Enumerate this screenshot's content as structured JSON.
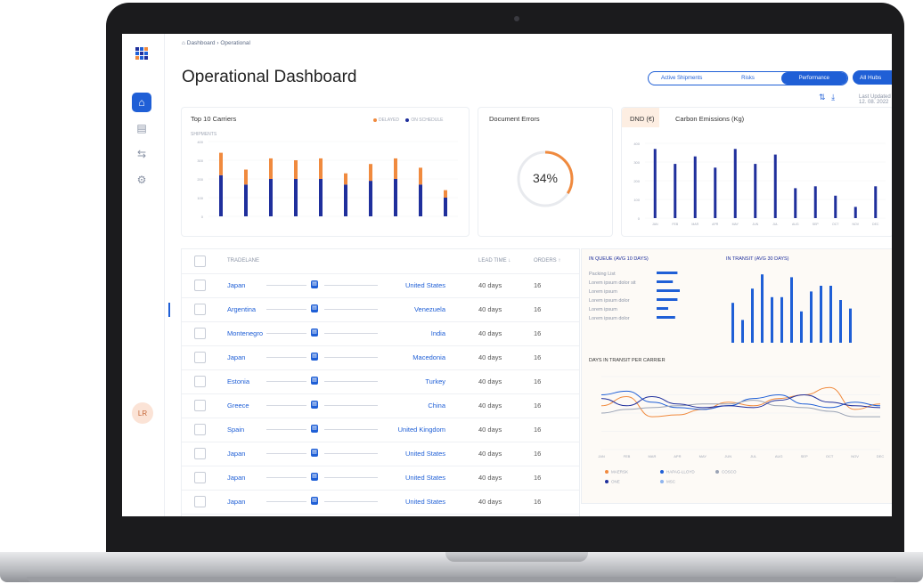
{
  "app": {
    "breadcrumb": [
      "Dashboard",
      "Operational"
    ],
    "page_title": "Operational Dashboard",
    "tabs": [
      "Active Shipments",
      "Risks",
      "Performance"
    ],
    "active_tab": "Performance",
    "hubs_select": "All Hubs",
    "last_updated": "Last Updated 12. 08. 2022",
    "avatar_initials": "LR",
    "colors": {
      "accent": "#1f5fd6",
      "orange": "#f08a3e",
      "navy": "#1f2f9c"
    }
  },
  "top_carriers": {
    "title": "Top 10 Carriers",
    "legend": [
      {
        "label": "DELAYED",
        "color": "#f08a3e"
      },
      {
        "label": "ON SCHEDULE",
        "color": "#1f2f9c"
      }
    ],
    "ylabel": "SHIPMENTS",
    "yticks": [
      "400",
      "300",
      "200",
      "100",
      "0"
    ]
  },
  "document_errors": {
    "title": "Document Errors",
    "value": "34%",
    "fraction": 0.34
  },
  "dnd": {
    "tab_dnd": "DND (€)",
    "tab_carbon": "Carbon Emissions (Kg)",
    "yticks": [
      "400",
      "300",
      "200",
      "100",
      "0"
    ]
  },
  "table": {
    "headers": {
      "tradelane": "TRADELANE",
      "lead_time": "LEAD TIME ↓",
      "orders": "ORDERS ↑"
    },
    "rows": [
      {
        "origin": "Japan",
        "dest": "United States",
        "lead": "40 days",
        "orders": "16"
      },
      {
        "origin": "Argentina",
        "dest": "Venezuela",
        "lead": "40 days",
        "orders": "16"
      },
      {
        "origin": "Montenegro",
        "dest": "India",
        "lead": "40 days",
        "orders": "16"
      },
      {
        "origin": "Japan",
        "dest": "Macedonia",
        "lead": "40 days",
        "orders": "16"
      },
      {
        "origin": "Estonia",
        "dest": "Turkey",
        "lead": "40 days",
        "orders": "16"
      },
      {
        "origin": "Greece",
        "dest": "China",
        "lead": "40 days",
        "orders": "16"
      },
      {
        "origin": "Spain",
        "dest": "United Kingdom",
        "lead": "40 days",
        "orders": "16"
      },
      {
        "origin": "Japan",
        "dest": "United States",
        "lead": "40 days",
        "orders": "16"
      },
      {
        "origin": "Japan",
        "dest": "United States",
        "lead": "40 days",
        "orders": "16"
      },
      {
        "origin": "Japan",
        "dest": "United States",
        "lead": "40 days",
        "orders": "16"
      }
    ]
  },
  "in_queue": {
    "title": "IN QUEUE (AVG 10 DAYS)",
    "items": [
      "Packing List",
      "Lorem ipsum dolor sit",
      "Lorem ipsum",
      "Lorem ipsum dolor",
      "Lorem ipsum",
      "Lorem ipsum dolor"
    ]
  },
  "in_transit": {
    "title": "IN TRANSIT (AVG 30 DAYS)"
  },
  "days_in_transit": {
    "title": "DAYS IN TRANSIT PER CARRIER",
    "months": [
      "JAN",
      "FEB",
      "MAR",
      "APR",
      "MAY",
      "JUN",
      "JUL",
      "AUG",
      "SEP",
      "OCT",
      "NOV",
      "DEC"
    ],
    "legend": [
      {
        "label": "MAERSK",
        "color": "#f08a3e"
      },
      {
        "label": "HAPAG-LLOYD",
        "color": "#1f5fd6"
      },
      {
        "label": "COSCO",
        "color": "#9aa3b5"
      },
      {
        "label": "ONE",
        "color": "#1f2f9c"
      },
      {
        "label": "MSC",
        "color": "#8fb4ee"
      }
    ]
  },
  "chart_data": [
    {
      "type": "bar",
      "title": "Top 10 Carriers",
      "stacked": true,
      "series": [
        {
          "name": "DELAYED",
          "values": [
            120,
            80,
            110,
            100,
            110,
            60,
            90,
            110,
            90,
            40
          ]
        },
        {
          "name": "ON SCHEDULE",
          "values": [
            220,
            170,
            200,
            200,
            200,
            170,
            190,
            200,
            170,
            100
          ]
        }
      ],
      "ylim": [
        0,
        400
      ]
    },
    {
      "type": "bar",
      "title": "DND (€)",
      "values": [
        370,
        290,
        330,
        270,
        370,
        290,
        340,
        160,
        170,
        120,
        60,
        170
      ],
      "ylim": [
        0,
        400
      ]
    },
    {
      "type": "bar",
      "title": "IN QUEUE (AVG 10 DAYS)",
      "orientation": "horizontal",
      "categories": [
        "Packing List",
        "Lorem ipsum dolor sit",
        "Lorem ipsum",
        "Lorem ipsum dolor",
        "Lorem ipsum",
        "Lorem ipsum dolor"
      ],
      "values": [
        9,
        7,
        10,
        9,
        5,
        8
      ]
    },
    {
      "type": "bar",
      "title": "IN TRANSIT (AVG 30 DAYS)",
      "values": [
        14,
        8,
        19,
        24,
        16,
        16,
        23,
        11,
        18,
        20,
        20,
        15,
        12
      ],
      "ylim": [
        0,
        25
      ]
    },
    {
      "type": "line",
      "title": "DAYS IN TRANSIT PER CARRIER",
      "x": [
        "JAN",
        "FEB",
        "MAR",
        "APR",
        "MAY",
        "JUN",
        "JUL",
        "AUG",
        "SEP",
        "OCT",
        "NOV",
        "DEC"
      ],
      "series": [
        {
          "name": "MAERSK",
          "values": [
            240,
            290,
            180,
            190,
            220,
            260,
            240,
            280,
            300,
            340,
            220,
            250
          ]
        },
        {
          "name": "HAPAG-LLOYD",
          "values": [
            300,
            320,
            260,
            230,
            220,
            240,
            280,
            300,
            250,
            230,
            260,
            240
          ]
        },
        {
          "name": "COSCO",
          "values": [
            200,
            220,
            230,
            240,
            250,
            250,
            270,
            240,
            230,
            210,
            180,
            180
          ]
        },
        {
          "name": "ONE",
          "values": [
            280,
            240,
            290,
            250,
            230,
            240,
            230,
            270,
            300,
            260,
            240,
            230
          ]
        }
      ],
      "ylim": [
        0,
        400
      ]
    }
  ]
}
